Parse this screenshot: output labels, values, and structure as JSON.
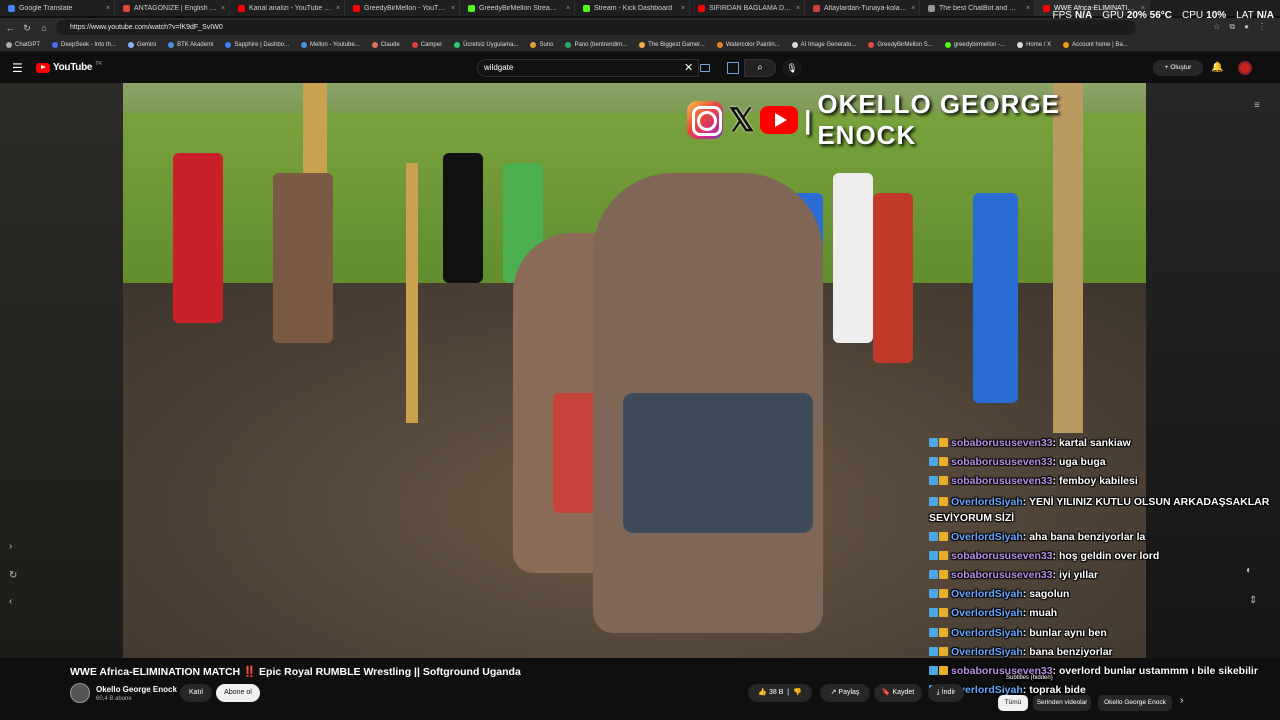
{
  "browser": {
    "tabs": [
      {
        "label": "Google Translate",
        "color": "#4285f4"
      },
      {
        "label": "ANTAGONIZE | English meaning",
        "color": "#e0463a"
      },
      {
        "label": "Kanal analizi - YouTube Studio",
        "color": "#ff0000"
      },
      {
        "label": "GreedyBirMellon - YouTube",
        "color": "#ff0000"
      },
      {
        "label": "GreedyBirMellon Stream - Watch",
        "color": "#53fc18"
      },
      {
        "label": "Stream - Kick Dashboard",
        "color": "#53fc18"
      },
      {
        "label": "SIFIRDAN BAĞLAMA DERSLERİ",
        "color": "#ff0000"
      },
      {
        "label": "Altaylardan-Tunaya-kolay-nota",
        "color": "#d04040"
      },
      {
        "label": "The best ChatBot and Widgets",
        "color": "#9a9a9a"
      },
      {
        "label": "WWE Africa-ELIMINATION M",
        "color": "#ff0000"
      }
    ],
    "url": "https://www.youtube.com/watch?v=fK9dF_SvIW0",
    "bookmarks": [
      {
        "label": "ChatGPT",
        "color": "#aaaaaa"
      },
      {
        "label": "DeepSeek - Into th...",
        "color": "#4a6cf7"
      },
      {
        "label": "Gemini",
        "color": "#8ab4f8"
      },
      {
        "label": "BTK Akademi",
        "color": "#4a90e2"
      },
      {
        "label": "Sapphire | Dashbo...",
        "color": "#3b82f6"
      },
      {
        "label": "Mellon - Youtube...",
        "color": "#4a90e2"
      },
      {
        "label": "Claude",
        "color": "#d97757"
      },
      {
        "label": "Camper",
        "color": "#e04040"
      },
      {
        "label": "Ücretsiz Uygulama...",
        "color": "#2ecc71"
      },
      {
        "label": "Suno",
        "color": "#f0a030"
      },
      {
        "label": "Pano (bentrendim...",
        "color": "#27ae60"
      },
      {
        "label": "The Biggest Gamer...",
        "color": "#f5b041"
      },
      {
        "label": "Watercolor Paintin...",
        "color": "#e67e22"
      },
      {
        "label": "AI Image Generato...",
        "color": "#dddddd"
      },
      {
        "label": "GreedyBirMellon S...",
        "color": "#e74c3c"
      },
      {
        "label": "greedybirmellon -...",
        "color": "#53fc18"
      },
      {
        "label": "Home / X",
        "color": "#dddddd"
      },
      {
        "label": "Account home | Ba...",
        "color": "#f39c12"
      }
    ]
  },
  "perf": {
    "fps_label": "FPS",
    "fps_value": "N/A",
    "gpu_label": "GPU",
    "gpu_value": "20% 56°C",
    "cpu_label": "CPU",
    "cpu_value": "10%",
    "lat_label": "LAT",
    "lat_value": "N/A"
  },
  "youtube": {
    "logo_text": "YouTube",
    "region": "TR",
    "search_value": "wildgate",
    "create_label": "Oluştur"
  },
  "video": {
    "brand_name": "OKELLO GEORGE ENOCK",
    "brand_sep": "|"
  },
  "chat": [
    {
      "user": "sobaborususeven33",
      "color": "#b88ee8",
      "text": ": kartal sankiaw"
    },
    {
      "user": "sobaborususeven33",
      "color": "#b88ee8",
      "text": ": uga buga"
    },
    {
      "user": "sobaborususeven33",
      "color": "#b88ee8",
      "text": ": femboy kabilesi"
    },
    {
      "user": "OverlordSiyah",
      "color": "#6aa8ff",
      "text": ": YENİ YILINIZ KUTLU OLSUN ARKADAŞSAKLAR SEVİYORUM SİZİ",
      "wrap": true
    },
    {
      "user": "OverlordSiyah",
      "color": "#6aa8ff",
      "text": ": aha bana benziyorlar la"
    },
    {
      "user": "sobaborususeven33",
      "color": "#b88ee8",
      "text": ": hoş geldin over lord"
    },
    {
      "user": "sobaborususeven33",
      "color": "#b88ee8",
      "text": ": iyi yıllar"
    },
    {
      "user": "OverlordSiyah",
      "color": "#6aa8ff",
      "text": ": sagolun"
    },
    {
      "user": "OverlordSiyah",
      "color": "#6aa8ff",
      "text": ": muah"
    },
    {
      "user": "OverlordSiyah",
      "color": "#6aa8ff",
      "text": ": bunlar aynı ben"
    },
    {
      "user": "OverlordSiyah",
      "color": "#6aa8ff",
      "text": ": bana benziyorlar"
    },
    {
      "user": "sobaborususeven33",
      "color": "#b88ee8",
      "text": ": overlord bunlar ustammm ı bile sikebilir"
    },
    {
      "user": "OverlordSiyah",
      "color": "#6aa8ff",
      "text": ": toprak bide"
    }
  ],
  "watch": {
    "title": "WWE Africa-ELIMINATION MATCH ‼️ Epic Royal RUMBLE Wrestling || Softground Uganda",
    "channel": "Okello George Enock",
    "subscribers": "60,4 B abone",
    "join_label": "Katıl",
    "subscribe_label": "Abone ol",
    "likes": "38 B",
    "share_label": "Paylaş",
    "save_label": "Kaydet",
    "more_label": "İndir",
    "subtitles_label": "Subtitles (hidden)",
    "chips": [
      "Tümü",
      "Serinden videolar",
      "Okello George Enock"
    ]
  }
}
